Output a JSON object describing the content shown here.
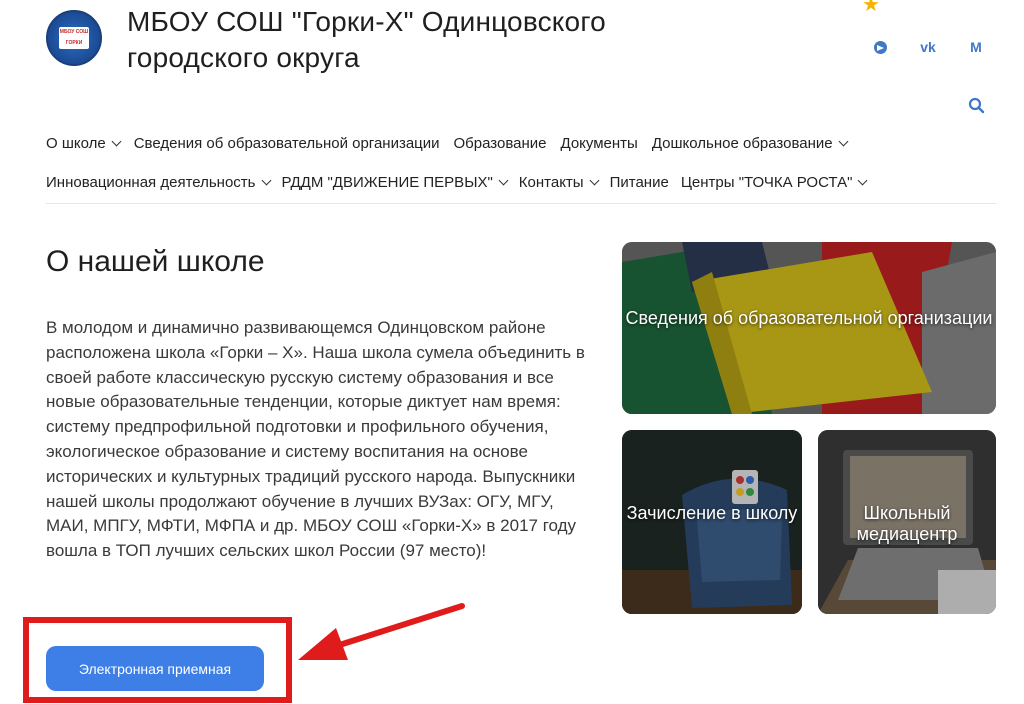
{
  "header": {
    "title": "МБОУ СОШ \"Горки-Х\" Одинцовского городского округа",
    "logo_text": "МБОУ СОШ ГОРКИ"
  },
  "social": {
    "icons": [
      "telegram-icon",
      "vk-icon",
      "max-icon"
    ],
    "vk_label": "vk",
    "m_label": "M"
  },
  "nav": {
    "row1": [
      {
        "label": "О школе",
        "dropdown": true
      },
      {
        "label": "Сведения об образовательной организации",
        "dropdown": false
      },
      {
        "label": "Образование",
        "dropdown": false
      },
      {
        "label": "Документы",
        "dropdown": false
      },
      {
        "label": "Дошкольное образование",
        "dropdown": true
      }
    ],
    "row2": [
      {
        "label": "Инновационная деятельность",
        "dropdown": true
      },
      {
        "label": "РДДМ \"ДВИЖЕНИЕ ПЕРВЫХ\"",
        "dropdown": true
      },
      {
        "label": "Контакты",
        "dropdown": true
      },
      {
        "label": "Питание",
        "dropdown": false
      },
      {
        "label": "Центры \"ТОЧКА РОСТА\"",
        "dropdown": true
      }
    ]
  },
  "about": {
    "title": "О нашей школе",
    "text": "В молодом и динамично развивающемся Одинцовском районе расположена школа «Горки – Х». Наша школа сумела объединить в своей работе классическую русскую систему образования и все новые образовательные тенденции, которые диктует нам время: систему предпрофильной подготовки и профильного обучения, экологическое образование и систему воспитания на основе исторических и культурных традиций русского народа. Выпускники нашей школы продолжают обучение в лучших ВУЗах: ОГУ, МГУ, МАИ, МПГУ, МФТИ, МФПА и др. МБОУ СОШ «Горки-Х» в 2017 году вошла в ТОП лучших сельских школ России (97 место)!",
    "button_label": "Электронная приемная"
  },
  "cards": {
    "card1": {
      "label": "Сведения об образовательной организации"
    },
    "card2": {
      "label": "Зачисление в школу"
    },
    "card3": {
      "label": "Школьный медиацентр"
    }
  },
  "colors": {
    "accent": "#3d7fe6",
    "annotation": "#e01b1b",
    "social": "#3e78c7"
  }
}
